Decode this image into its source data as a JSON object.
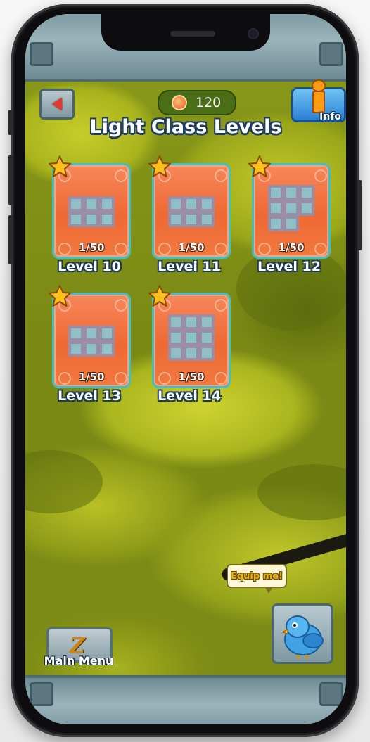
{
  "header": {
    "coins": "120",
    "info_label": "Info",
    "title": "Light Class Levels"
  },
  "levels": [
    {
      "label": "Level 10",
      "progress": "1/50",
      "pattern": [
        "111",
        "111"
      ]
    },
    {
      "label": "Level 11",
      "progress": "1/50",
      "pattern": [
        "111",
        "111"
      ]
    },
    {
      "label": "Level 12",
      "progress": "1/50",
      "pattern": [
        "111",
        "111",
        "110"
      ]
    },
    {
      "label": "Level 13",
      "progress": "1/50",
      "pattern": [
        "111",
        "111"
      ]
    },
    {
      "label": "Level 14",
      "progress": "1/50",
      "pattern": [
        "111",
        "111",
        "111"
      ]
    }
  ],
  "bird": {
    "speech": "Equip me!"
  },
  "footer": {
    "main_menu_label": "Main Menu"
  },
  "colors": {
    "card_fill": "#ef6834",
    "card_border": "#3fc1c4",
    "title_outline": "#1f3c62",
    "star": "#ffbf1a",
    "info_button": "#2b7fd4"
  }
}
